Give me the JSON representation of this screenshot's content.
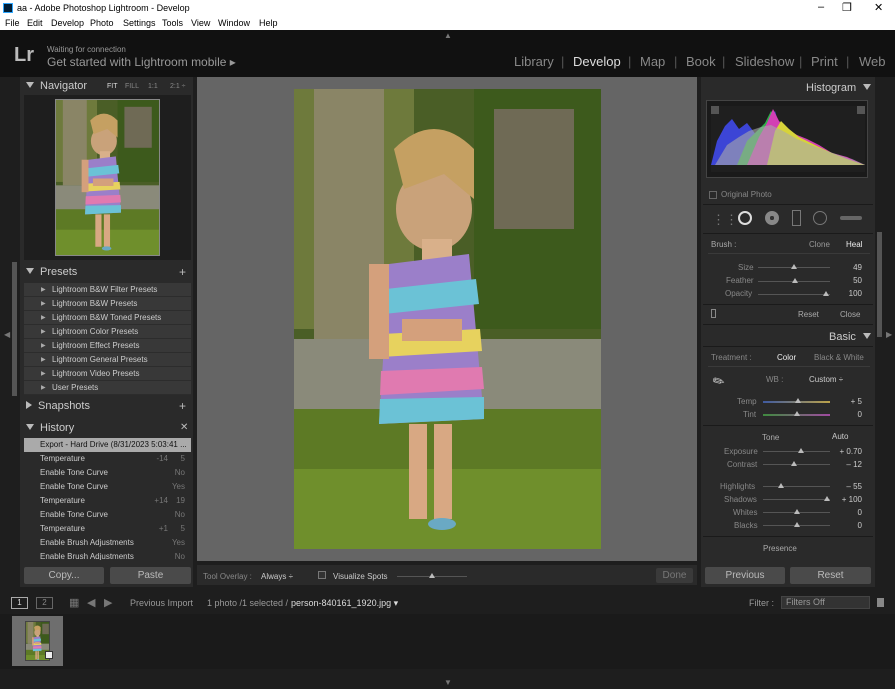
{
  "window": {
    "title": "aa - Adobe Photoshop Lightroom - Develop"
  },
  "menu": [
    "File",
    "Edit",
    "Develop",
    "Photo",
    "Settings",
    "Tools",
    "View",
    "Window",
    "Help"
  ],
  "identity": {
    "logo": "Lr",
    "status": "Waiting for connection",
    "promo": "Get started with Lightroom mobile ▸"
  },
  "modules": [
    "Library",
    "Develop",
    "Map",
    "Book",
    "Slideshow",
    "Print",
    "Web"
  ],
  "navigator": {
    "title": "Navigator",
    "fit": "FIT",
    "fill": "FILL",
    "one": "1:1",
    "two": "2:1 ÷"
  },
  "presets": {
    "title": "Presets",
    "items": [
      "Lightroom B&W Filter Presets",
      "Lightroom B&W Presets",
      "Lightroom B&W Toned Presets",
      "Lightroom Color Presets",
      "Lightroom Effect Presets",
      "Lightroom General Presets",
      "Lightroom Video Presets",
      "User Presets"
    ]
  },
  "snapshots": {
    "title": "Snapshots"
  },
  "history": {
    "title": "History",
    "items": [
      {
        "label": "Export - Hard Drive (8/31/2023 5:03:41 ...",
        "b": "",
        "a": ""
      },
      {
        "label": "Temperature",
        "b": "-14",
        "a": "5"
      },
      {
        "label": "Enable Tone Curve",
        "b": "",
        "a": "No"
      },
      {
        "label": "Enable Tone Curve",
        "b": "",
        "a": "Yes"
      },
      {
        "label": "Temperature",
        "b": "+14",
        "a": "19"
      },
      {
        "label": "Enable Tone Curve",
        "b": "",
        "a": "No"
      },
      {
        "label": "Temperature",
        "b": "+1",
        "a": "5"
      },
      {
        "label": "Enable Brush Adjustments",
        "b": "",
        "a": "Yes"
      },
      {
        "label": "Enable Brush Adjustments",
        "b": "",
        "a": "No"
      }
    ]
  },
  "leftbuttons": {
    "copy": "Copy...",
    "paste": "Paste"
  },
  "histogram": {
    "title": "Histogram",
    "original": "Original Photo"
  },
  "brush": {
    "label": "Brush :",
    "clone": "Clone",
    "heal": "Heal",
    "size_label": "Size",
    "size": "49",
    "feather_label": "Feather",
    "feather": "50",
    "opacity_label": "Opacity",
    "opacity": "100",
    "reset": "Reset",
    "close": "Close"
  },
  "basic": {
    "title": "Basic",
    "treatment_label": "Treatment :",
    "color": "Color",
    "bw": "Black & White",
    "wb_label": "WB :",
    "wb": "Custom ÷",
    "temp_label": "Temp",
    "temp": "+ 5",
    "tint_label": "Tint",
    "tint": "0",
    "tone": "Tone",
    "auto": "Auto",
    "exposure_label": "Exposure",
    "exposure": "+ 0.70",
    "contrast_label": "Contrast",
    "contrast": "– 12",
    "highlights_label": "Highlights",
    "highlights": "– 55",
    "shadows_label": "Shadows",
    "shadows": "+ 100",
    "whites_label": "Whites",
    "whites": "0",
    "blacks_label": "Blacks",
    "blacks": "0",
    "presence": "Presence"
  },
  "rightbuttons": {
    "previous": "Previous",
    "reset": "Reset"
  },
  "toolbar": {
    "overlay_label": "Tool Overlay :",
    "overlay": "Always ÷",
    "visualize": "Visualize Spots",
    "done": "Done"
  },
  "filmstrip": {
    "one": "1",
    "two": "2",
    "prev_import": "Previous Import",
    "count": "1 photo /1 selected /",
    "filename": "person-840161_1920.jpg ▾",
    "filter_label": "Filter :",
    "filter": "Filters Off"
  },
  "colors": {
    "panel": "#2a2a2a",
    "bg": "#1e1e1e",
    "canvas": "#656565"
  }
}
